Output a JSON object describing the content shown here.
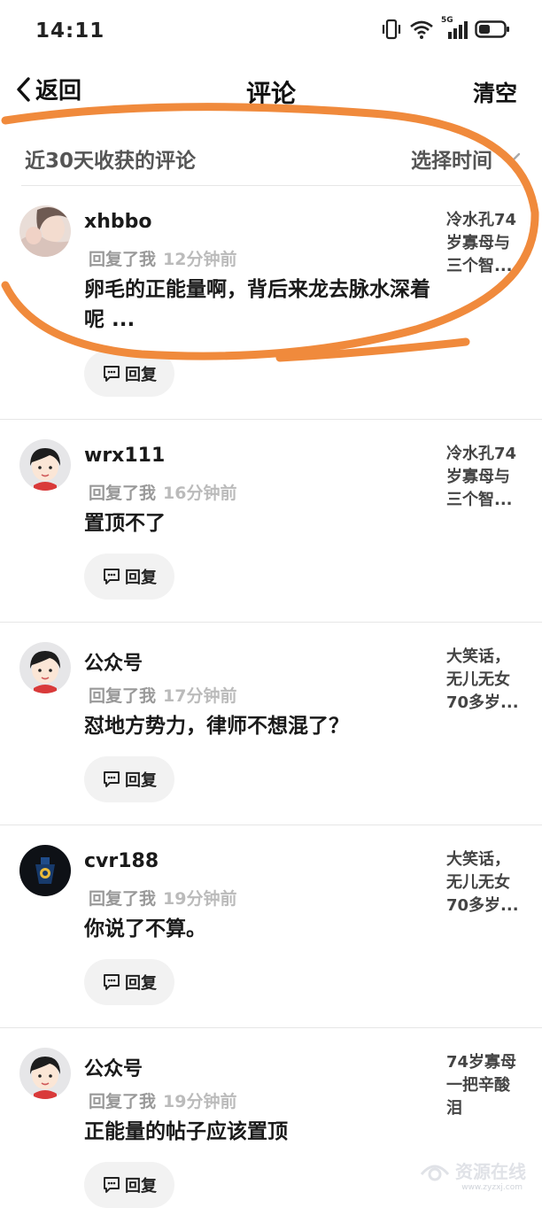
{
  "status_bar": {
    "time": "14:11",
    "network": "5G"
  },
  "nav": {
    "back_label": "返回",
    "title": "评论",
    "clear_label": "清空"
  },
  "filter": {
    "label": "近30天收获的评论",
    "time_select": "选择时间"
  },
  "reply_button_label": "回复",
  "comments": [
    {
      "username": "xhbbo",
      "action": "回复了我",
      "time": "12分钟前",
      "text": "卵毛的正能量啊，背后来龙去脉水深着呢 ...",
      "post": "冷水孔74岁寡母与三个智..."
    },
    {
      "username": "wrx111",
      "action": "回复了我",
      "time": "16分钟前",
      "text": "置顶不了",
      "post": "冷水孔74岁寡母与三个智..."
    },
    {
      "username": "公众号",
      "action": "回复了我",
      "time": "17分钟前",
      "text": "怼地方势力，律师不想混了？",
      "post": "大笑话，无儿无女70多岁..."
    },
    {
      "username": "cvr188",
      "action": "回复了我",
      "time": "19分钟前",
      "text": "你说了不算。",
      "post": "大笑话，无儿无女70多岁..."
    },
    {
      "username": "公众号",
      "action": "回复了我",
      "time": "19分钟前",
      "text": "正能量的帖子应该置顶",
      "post": "74岁寡母一把辛酸泪"
    }
  ],
  "watermark": {
    "text": "资源在线",
    "sub": "www.zyzxj.com"
  },
  "colors": {
    "annotation_stroke": "#f08a3c",
    "reply_bg": "#f2f2f2"
  }
}
